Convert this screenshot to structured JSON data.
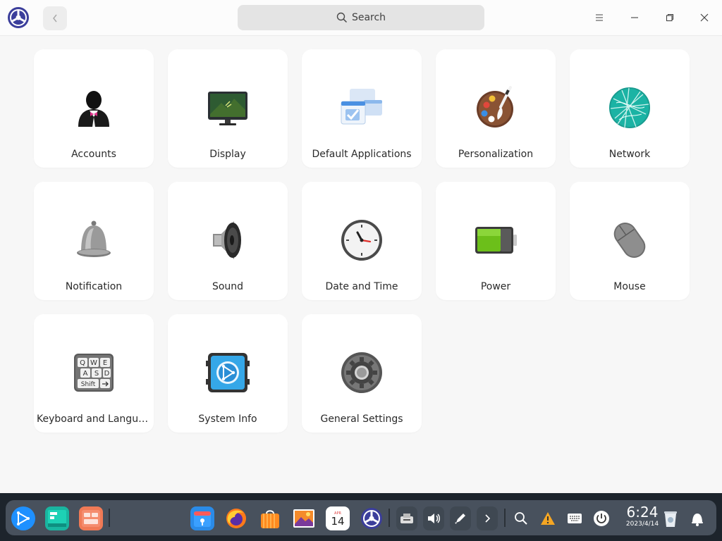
{
  "titlebar": {
    "search_placeholder": "Search"
  },
  "modules": [
    {
      "label": "Accounts",
      "icon": "accounts-icon"
    },
    {
      "label": "Display",
      "icon": "display-icon"
    },
    {
      "label": "Default Applications",
      "icon": "default-applications-icon"
    },
    {
      "label": "Personalization",
      "icon": "personalization-icon"
    },
    {
      "label": "Network",
      "icon": "network-icon"
    },
    {
      "label": "Notification",
      "icon": "bell-icon"
    },
    {
      "label": "Sound",
      "icon": "speaker-icon"
    },
    {
      "label": "Date and Time",
      "icon": "clock-icon"
    },
    {
      "label": "Power",
      "icon": "battery-icon"
    },
    {
      "label": "Mouse",
      "icon": "mouse-icon"
    },
    {
      "label": "Keyboard and Langua...",
      "icon": "keyboard-icon"
    },
    {
      "label": "System Info",
      "icon": "system-info-icon"
    },
    {
      "label": "General Settings",
      "icon": "gear-icon"
    }
  ],
  "dock": {
    "calendar_month": "APR",
    "calendar_day": "14",
    "keyboard_keys": [
      "Q",
      "W",
      "E",
      "A",
      "S",
      "D",
      "Shift"
    ],
    "time": "6:24",
    "date": "2023/4/14"
  },
  "colors": {
    "accent": "#1e90ff",
    "background": "#f7f7f7",
    "tile": "#ffffff",
    "dock": "#4e5864"
  }
}
